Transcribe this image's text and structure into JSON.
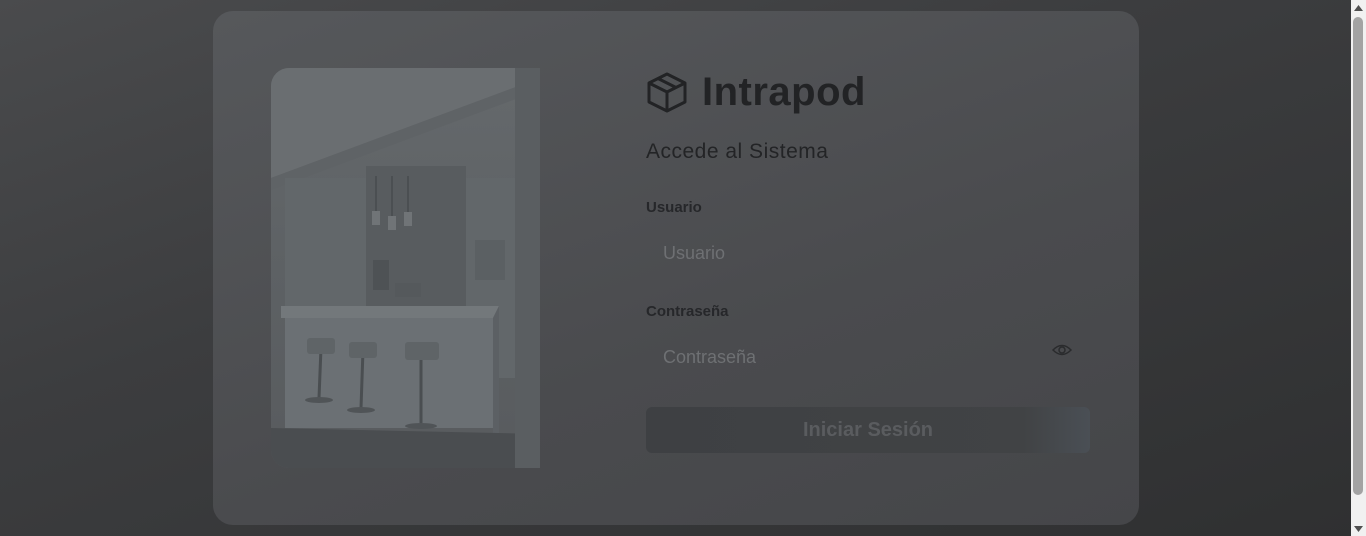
{
  "brand": {
    "name": "Intrapod",
    "icon": "box-icon"
  },
  "login": {
    "subtitle": "Accede al Sistema",
    "username_label": "Usuario",
    "username_placeholder": "Usuario",
    "username_value": "",
    "password_label": "Contraseña",
    "password_placeholder": "Contraseña",
    "password_value": "",
    "toggle_icon": "eye-icon",
    "submit_label": "Iniciar Sesión"
  },
  "photo": {
    "description_icon": "kitchen-photo"
  },
  "colors": {
    "background": "#3c3d3f",
    "card": "#505255",
    "text": "#232426",
    "button": "#404245"
  }
}
